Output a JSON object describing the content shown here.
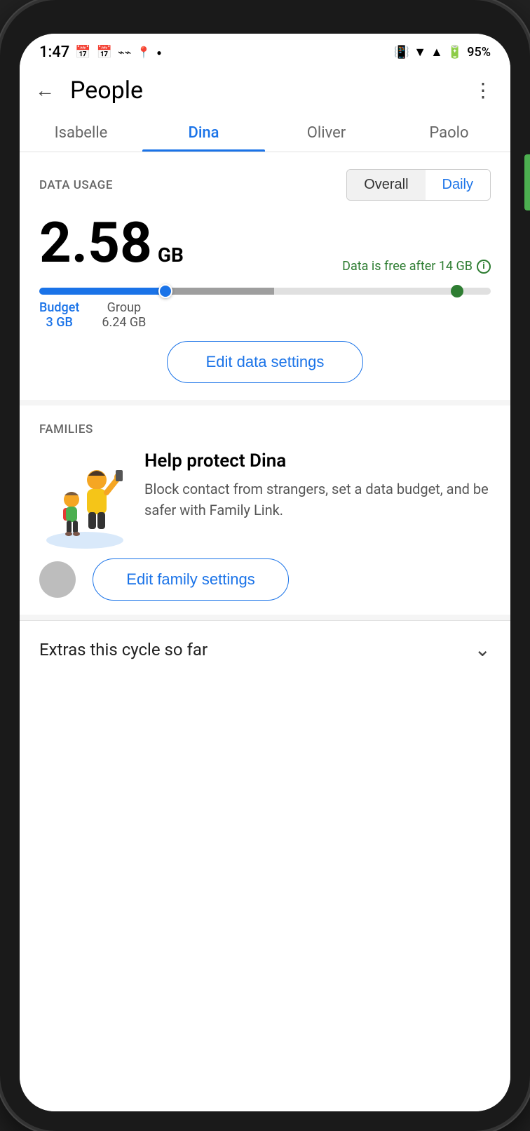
{
  "status_bar": {
    "time": "1:47",
    "battery": "95%"
  },
  "header": {
    "title": "People",
    "back_label": "←",
    "more_label": "⋮"
  },
  "tabs": [
    {
      "id": "isabelle",
      "label": "Isabelle",
      "active": false
    },
    {
      "id": "dina",
      "label": "Dina",
      "active": true
    },
    {
      "id": "oliver",
      "label": "Oliver",
      "active": false
    },
    {
      "id": "paolo",
      "label": "Paolo",
      "active": false
    }
  ],
  "data_usage": {
    "section_label": "DATA USAGE",
    "toggle_overall": "Overall",
    "toggle_daily": "Daily",
    "amount": "2.58",
    "unit": "GB",
    "free_note": "Data is free after 14 GB",
    "budget_label": "Budget",
    "budget_value": "3 GB",
    "group_label": "Group",
    "group_value": "6.24 GB",
    "edit_button": "Edit data settings",
    "progress_blue_pct": 28,
    "progress_gray_pct": 24
  },
  "families": {
    "section_label": "FAMILIES",
    "card_title": "Help protect Dina",
    "card_description": "Block contact from strangers, set a data budget, and be safer with Family Link.",
    "edit_button": "Edit family settings"
  },
  "extras": {
    "title": "Extras this cycle so far"
  }
}
